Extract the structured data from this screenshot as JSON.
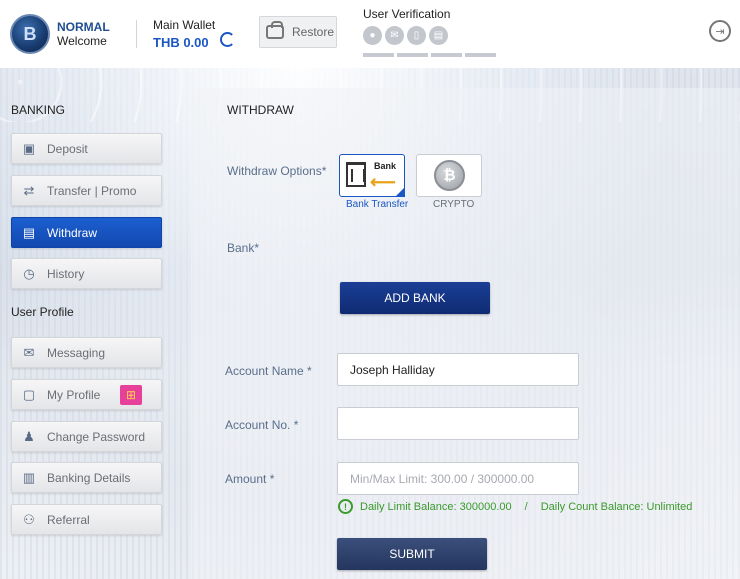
{
  "header": {
    "level": "NORMAL",
    "welcome": "Welcome",
    "wallet_label": "Main Wallet",
    "wallet_value": "THB 0.00",
    "restore_label": "Restore",
    "verification_title": "User Verification"
  },
  "sidebar": {
    "banking_title": "BANKING",
    "user_profile_title": "User Profile",
    "items": [
      {
        "label": "Deposit",
        "icon": "deposit-icon"
      },
      {
        "label": "Transfer | Promo",
        "icon": "transfer-icon"
      },
      {
        "label": "Withdraw",
        "icon": "withdraw-icon",
        "active": true
      },
      {
        "label": "History",
        "icon": "history-icon"
      },
      {
        "label": "Messaging",
        "icon": "envelope-icon"
      },
      {
        "label": "My Profile",
        "icon": "profile-icon"
      },
      {
        "label": "Change Password",
        "icon": "password-icon"
      },
      {
        "label": "Banking Details",
        "icon": "bank-icon"
      },
      {
        "label": "Referral",
        "icon": "referral-icon"
      }
    ]
  },
  "main": {
    "title": "WITHDRAW",
    "withdraw_options_label": "Withdraw Options*",
    "options": [
      {
        "caption": "Bank Transfer",
        "icon_text": "Bank",
        "selected": true
      },
      {
        "caption": "CRYPTO",
        "selected": false
      }
    ],
    "bank_label": "Bank*",
    "add_bank_label": "ADD BANK",
    "account_name_label": "Account Name *",
    "account_name_value": "Joseph Halliday",
    "account_no_label": "Account No. *",
    "account_no_value": "",
    "amount_label": "Amount  *",
    "amount_placeholder": "Min/Max Limit: 300.00 / 300000.00",
    "daily_limit": "Daily Limit Balance: 300000.00",
    "separator": "/",
    "daily_count": "Daily Count Balance: Unlimited",
    "submit_label": "SUBMIT"
  },
  "colors": {
    "accent_blue": "#1a56c4",
    "nav_active": "#1248b0",
    "success_green": "#3a9a2c"
  }
}
